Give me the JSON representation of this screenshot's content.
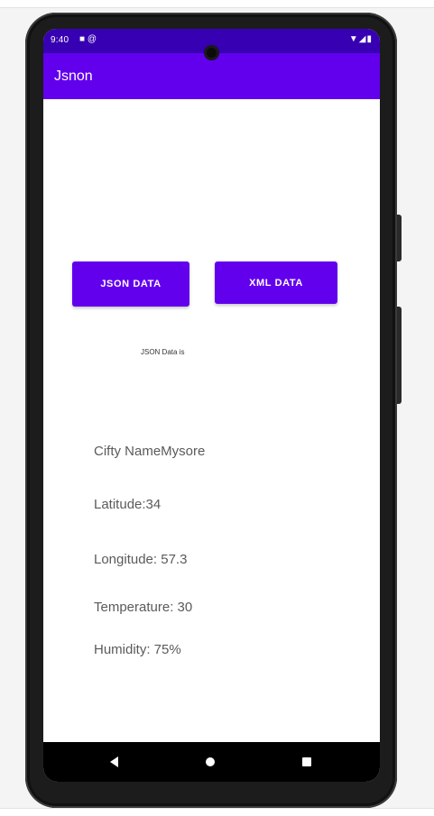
{
  "status_bar": {
    "time": "9:40",
    "left_icons": [
      "lock-icon",
      "at-icon"
    ],
    "right_icons": [
      "wifi-icon",
      "signal-icon",
      "battery-icon"
    ]
  },
  "app_bar": {
    "title": "Jsnon",
    "color": "#6200ee"
  },
  "buttons": {
    "json_label": "JSON DATA",
    "xml_label": "XML DATA"
  },
  "data_label": "JSON Data is",
  "info": {
    "city": "Cifty NameMysore",
    "latitude": "Latitude:34",
    "longitude": "Longitude: 57.3",
    "temperature": "Temperature: 30",
    "humidity": "Humidity: 75%"
  },
  "nav_bar": {
    "icons": [
      "back-icon",
      "home-icon",
      "recents-icon"
    ]
  },
  "colors": {
    "primary": "#6200ee",
    "status_bar": "#3700b3"
  }
}
